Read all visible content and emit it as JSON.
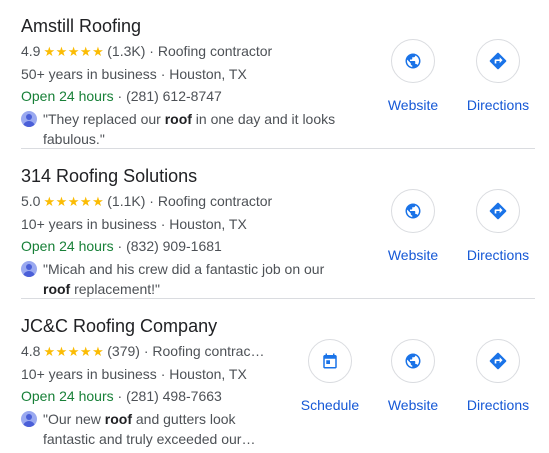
{
  "listings": [
    {
      "name": "Amstill Roofing",
      "rating": "4.9",
      "stars": "★★★★★",
      "reviews": "(1.3K)",
      "category": "Roofing contractor",
      "years": "50+ years in business",
      "location": "Houston, TX",
      "hours": "Open 24 hours",
      "phone": "(281) 612-8747",
      "review_before": "\"They replaced our ",
      "review_bold": "roof",
      "review_after": " in one day and it looks fabulous.\"",
      "website_label": "Website",
      "directions_label": "Directions"
    },
    {
      "name": "314 Roofing Solutions",
      "rating": "5.0",
      "stars": "★★★★★",
      "reviews": "(1.1K)",
      "category": "Roofing contractor",
      "years": "10+ years in business",
      "location": "Houston, TX",
      "hours": "Open 24 hours",
      "phone": "(832) 909-1681",
      "review_before": "\"Micah and his crew did a fantastic job on our ",
      "review_bold": "roof",
      "review_after": " replacement!\"",
      "website_label": "Website",
      "directions_label": "Directions"
    },
    {
      "name": "JC&C Roofing Company",
      "rating": "4.8",
      "stars": "★★★★★",
      "reviews": "(379)",
      "category": "Roofing contrac…",
      "years": "10+ years in business",
      "location": "Houston, TX",
      "hours": "Open 24 hours",
      "phone": "(281) 498-7663",
      "review_before": "\"Our new ",
      "review_bold": "roof",
      "review_after": " and gutters look fantastic and truly exceeded our…",
      "schedule_label": "Schedule",
      "website_label": "Website",
      "directions_label": "Directions"
    }
  ],
  "separator": "·",
  "colors": {
    "star": "#fbbc04",
    "open": "#188038",
    "link": "#1558d6"
  },
  "icons": {
    "website": "globe-icon",
    "directions": "directions-icon",
    "schedule": "calendar-icon"
  }
}
